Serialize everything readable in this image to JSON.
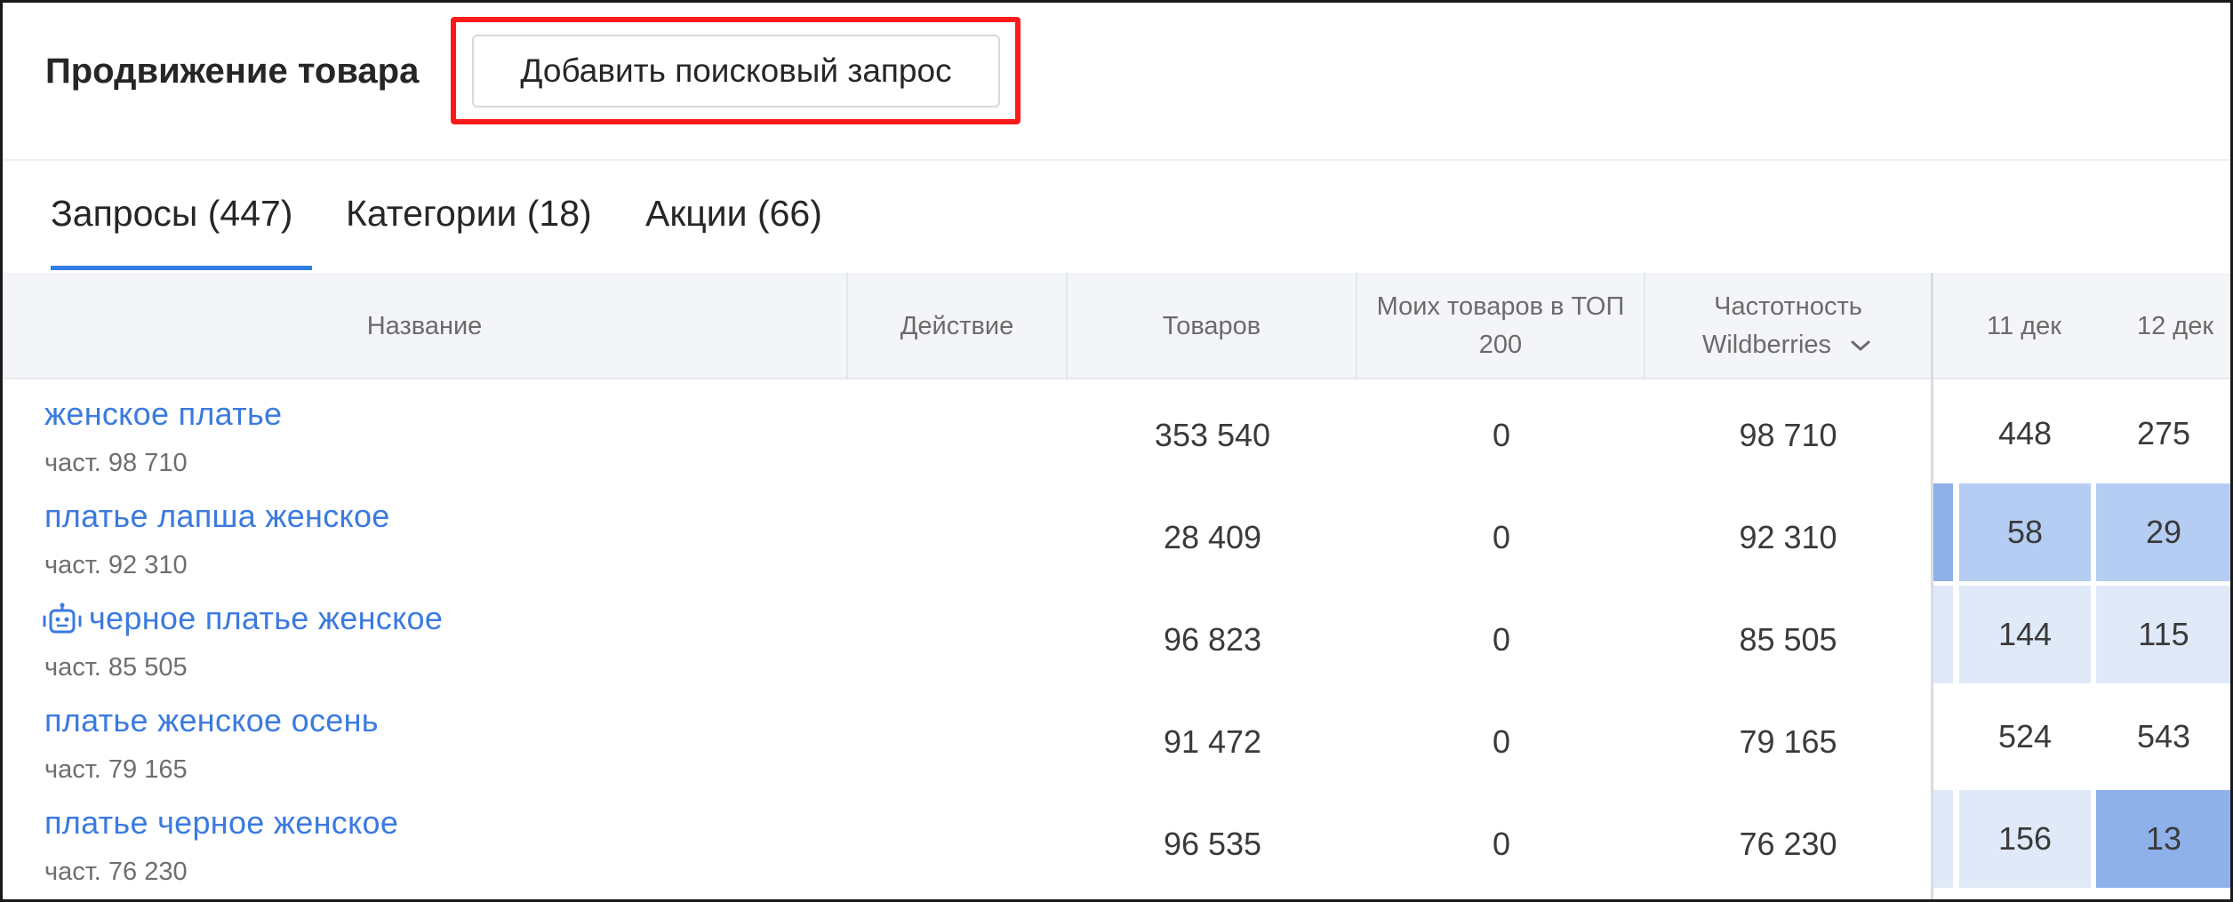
{
  "header": {
    "title": "Продвижение товара",
    "add_query_label": "Добавить поисковый запрос"
  },
  "tabs": [
    {
      "label": "Запросы (447)",
      "active": true
    },
    {
      "label": "Категории (18)",
      "active": false
    },
    {
      "label": "Акции (66)",
      "active": false
    }
  ],
  "table": {
    "columns": {
      "name": "Название",
      "action": "Действие",
      "products": "Товаров",
      "my_top_line1": "Моих товаров в ТОП",
      "my_top_line2": "200",
      "freq_line1": "Частотность",
      "freq_line2": "Wildberries",
      "date1": "11 дек",
      "date2": "12 дек"
    },
    "rows": [
      {
        "query": "женское платье",
        "freq_label": "част. 98 710",
        "products": "353 540",
        "my_top": "0",
        "frequency": "98 710",
        "d1": "448",
        "d2": "275",
        "d1_color": "#ffffff",
        "d2_color": "#ffffff",
        "robot": false
      },
      {
        "query": "платье лапша женское",
        "freq_label": "част. 92 310",
        "products": "28 409",
        "my_top": "0",
        "frequency": "92 310",
        "d1": "58",
        "d2": "29",
        "d1_color": "#b5cdf2",
        "d2_color": "#b5cdf2",
        "robot": false
      },
      {
        "query": "черное платье женское",
        "freq_label": "част. 85 505",
        "products": "96 823",
        "my_top": "0",
        "frequency": "85 505",
        "d1": "144",
        "d2": "115",
        "d1_color": "#dfe9f8",
        "d2_color": "#dfe9f8",
        "robot": true
      },
      {
        "query": "платье женское осень",
        "freq_label": "част. 79 165",
        "products": "91 472",
        "my_top": "0",
        "frequency": "79 165",
        "d1": "524",
        "d2": "543",
        "d1_color": "#ffffff",
        "d2_color": "#ffffff",
        "robot": false
      },
      {
        "query": "платье черное женское",
        "freq_label": "част. 76 230",
        "products": "96 535",
        "my_top": "0",
        "frequency": "76 230",
        "d1": "156",
        "d2": "13",
        "d1_color": "#dfe9f8",
        "d2_color": "#8eb1ea",
        "robot": false
      }
    ]
  },
  "colors": {
    "accent": "#2f7de1",
    "link": "#3b7ae0",
    "highlight": "#ff1a1a"
  }
}
